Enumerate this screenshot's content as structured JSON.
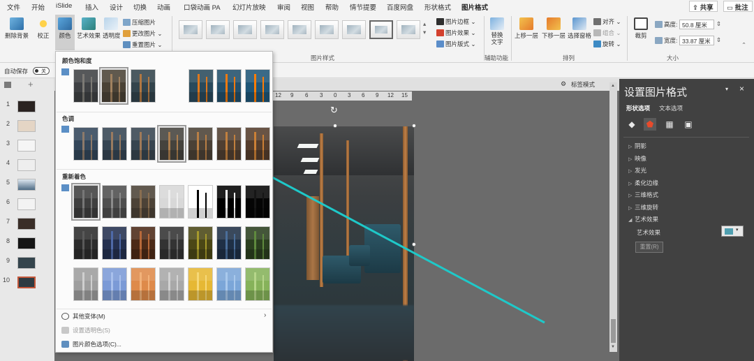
{
  "ribbon_tabs": [
    {
      "label": "文件"
    },
    {
      "label": "开始"
    },
    {
      "label": "iSlide"
    },
    {
      "label": "插入"
    },
    {
      "label": "设计"
    },
    {
      "label": "切换"
    },
    {
      "label": "动画"
    },
    {
      "label": "口袋动画 PA"
    },
    {
      "label": "幻灯片放映"
    },
    {
      "label": "审阅"
    },
    {
      "label": "视图"
    },
    {
      "label": "帮助"
    },
    {
      "label": "情节提要"
    },
    {
      "label": "百度网盘"
    },
    {
      "label": "形状格式"
    },
    {
      "label": "图片格式"
    }
  ],
  "header_buttons": {
    "share": "共享",
    "comments": "批注"
  },
  "ribbon": {
    "remove_bg": "删除背景",
    "corrections": "校正",
    "color": "颜色",
    "artistic": "艺术效果",
    "transparency": "透明度",
    "compress": "压缩图片",
    "change": "更改图片",
    "reset": "重置图片",
    "picture_border": "图片边框",
    "picture_effects": "图片效果",
    "picture_layout": "图片版式",
    "styles_group": "图片样式",
    "alt_text": "替换文字",
    "accessibility_group": "辅助功能",
    "bring_forward": "上移一层",
    "send_backward": "下移一层",
    "selection_pane": "选择窗格",
    "align": "对齐",
    "group": "组合",
    "rotate": "旋转",
    "arrange_group": "排列",
    "crop": "裁剪",
    "height_label": "高度:",
    "height_value": "50.8 厘米",
    "width_label": "宽度:",
    "width_value": "33.87 厘米",
    "size_group": "大小"
  },
  "qat": {
    "autosave": "自动保存",
    "toggle": "关"
  },
  "slides": [
    {
      "num": "1"
    },
    {
      "num": "2"
    },
    {
      "num": "3"
    },
    {
      "num": "4"
    },
    {
      "num": "5"
    },
    {
      "num": "6"
    },
    {
      "num": "7"
    },
    {
      "num": "8"
    },
    {
      "num": "9"
    },
    {
      "num": "10"
    }
  ],
  "ruler_numbers": [
    "12",
    "9",
    "6",
    "3",
    "0",
    "3",
    "6",
    "9",
    "12",
    "15"
  ],
  "view_label": "标签模式",
  "dropdown": {
    "saturation_title": "颜色饱和度",
    "tone_title": "色调",
    "recolor_title": "重新着色",
    "more_variants": "其他变体(M)",
    "set_transparent": "设置透明色(S)",
    "color_options": "图片颜色选项(C)...",
    "saturation_swatches": [
      {
        "tint": "#3f4144",
        "pole": "#7c7a75",
        "sel": false
      },
      {
        "tint": "#4a4236",
        "pole": "#a0815f",
        "sel": true
      },
      {
        "tint": "#33444c",
        "pole": "#b27842",
        "sel": false
      },
      {
        "tint": "#2a4a5c",
        "pole": "#e0781c",
        "sel": false
      },
      {
        "tint": "#23506c",
        "pole": "#f07a10",
        "sel": false
      },
      {
        "tint": "#1f5677",
        "pole": "#ff7d05",
        "sel": false
      }
    ],
    "tone_swatches": [
      {
        "tint": "#33465a",
        "pole": "#8d7a6a",
        "sel": false
      },
      {
        "tint": "#354553",
        "pole": "#9a7b60",
        "sel": false
      },
      {
        "tint": "#374550",
        "pole": "#a07a58",
        "sel": false
      },
      {
        "tint": "#45433d",
        "pole": "#ad7f4f",
        "sel": true
      },
      {
        "tint": "#4b4136",
        "pole": "#b97f45",
        "sel": false
      },
      {
        "tint": "#503f31",
        "pole": "#c2803e",
        "sel": false
      },
      {
        "tint": "#553d2c",
        "pole": "#cc8036",
        "sel": false
      }
    ],
    "recolor_rows": [
      [
        {
          "tint": "#3f3f3f",
          "pole": "#777777",
          "sel": true
        },
        {
          "tint": "#4e4e4e",
          "pole": "#8c8c8c",
          "sel": false
        },
        {
          "tint": "#4c4237",
          "pole": "#8a6e50",
          "sel": false
        },
        {
          "tint": "#d8d8d8",
          "pole": "#eeeeee",
          "sel": false
        },
        {
          "tint": "#ffffff",
          "pole": "#000000",
          "sel": false
        },
        {
          "tint": "#000000",
          "pole": "#ffffff",
          "sel": false
        },
        {
          "tint": "#050505",
          "pole": "#161616",
          "sel": false
        }
      ],
      [
        {
          "tint": "#2c2c2c",
          "pole": "#5a5a5a",
          "sel": false
        },
        {
          "tint": "#24304f",
          "pole": "#4f6aa8",
          "sel": false
        },
        {
          "tint": "#4c2a17",
          "pole": "#b96a3a",
          "sel": false
        },
        {
          "tint": "#333333",
          "pole": "#6e6e6e",
          "sel": false
        },
        {
          "tint": "#4b4716",
          "pole": "#a69a2c",
          "sel": false
        },
        {
          "tint": "#1f3046",
          "pole": "#4a6e9a",
          "sel": false
        },
        {
          "tint": "#2b3f1f",
          "pole": "#5f8a3e",
          "sel": false
        }
      ],
      [
        {
          "tint": "#9e9e9e",
          "pole": "#cfcfcf",
          "sel": false
        },
        {
          "tint": "#7b9ad6",
          "pole": "#a9c0ec",
          "sel": false
        },
        {
          "tint": "#de8a4a",
          "pole": "#f2b27a",
          "sel": false
        },
        {
          "tint": "#a8a8a8",
          "pole": "#d2d2d2",
          "sel": false
        },
        {
          "tint": "#e6b834",
          "pole": "#f6d878",
          "sel": false
        },
        {
          "tint": "#7ba6d8",
          "pole": "#a9c9ec",
          "sel": false
        },
        {
          "tint": "#86b25a",
          "pole": "#b6d68a",
          "sel": false
        }
      ]
    ]
  },
  "pane": {
    "title": "设置图片格式",
    "tab_shape": "形状选项",
    "tab_text": "文本选项",
    "sections": [
      {
        "label": "阴影",
        "expanded": false
      },
      {
        "label": "映像",
        "expanded": false
      },
      {
        "label": "发光",
        "expanded": false
      },
      {
        "label": "柔化边缘",
        "expanded": false
      },
      {
        "label": "三维格式",
        "expanded": false
      },
      {
        "label": "三维旋转",
        "expanded": false
      },
      {
        "label": "艺术效果",
        "expanded": true
      }
    ],
    "artistic_label": "艺术效果",
    "reset_label": "重置(R)"
  },
  "colors": {
    "accent": "#1ec9c9",
    "active_slide": "#c4573a",
    "pane_bg": "#414141"
  }
}
